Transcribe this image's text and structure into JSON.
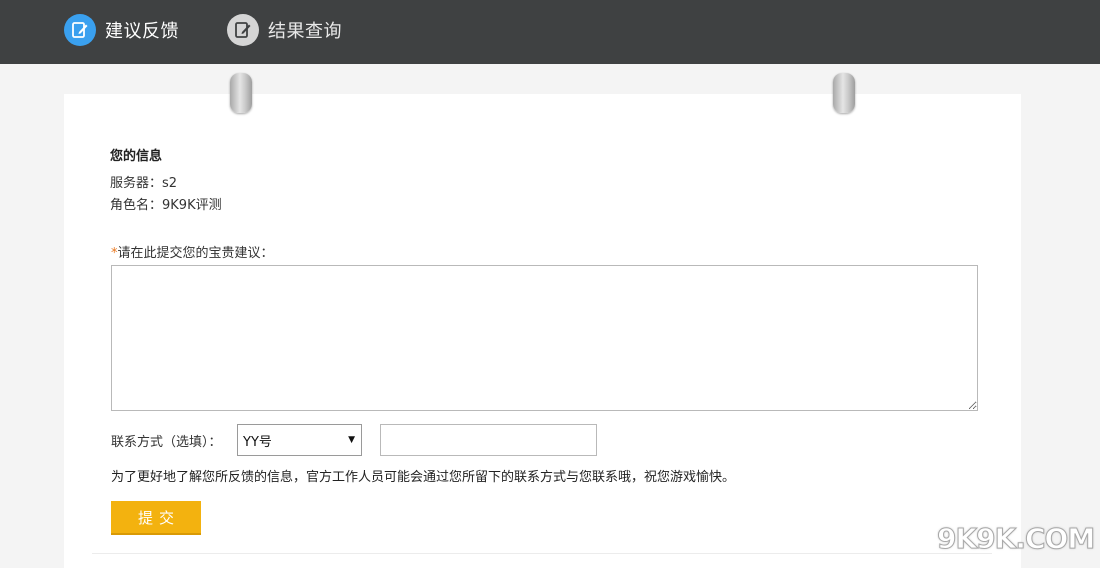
{
  "nav": {
    "tabs": [
      {
        "label": "建议反馈",
        "icon": "edit-icon",
        "active": true
      },
      {
        "label": "结果查询",
        "icon": "edit-icon",
        "active": false
      }
    ]
  },
  "info": {
    "title": "您的信息",
    "server_label": "服务器：",
    "server_value": "s2",
    "role_label": "角色名：",
    "role_value": "9K9K评测"
  },
  "form": {
    "required_mark": "*",
    "suggestion_prompt": "请在此提交您的宝贵建议：",
    "suggestion_value": "",
    "contact_label": "联系方式（选填）：",
    "contact_type_selected": "YY号",
    "contact_value": "",
    "notice": "为了更好地了解您所反馈的信息，官方工作人员可能会通过您所留下的联系方式与您联系哦，祝您游戏愉快。",
    "submit_label": "提交"
  },
  "watermark": "9K9K.COM",
  "colors": {
    "topbar": "#3f4142",
    "active_icon": "#3aa0ef",
    "submit": "#f3b20f",
    "required_mark": "#e8761d"
  }
}
